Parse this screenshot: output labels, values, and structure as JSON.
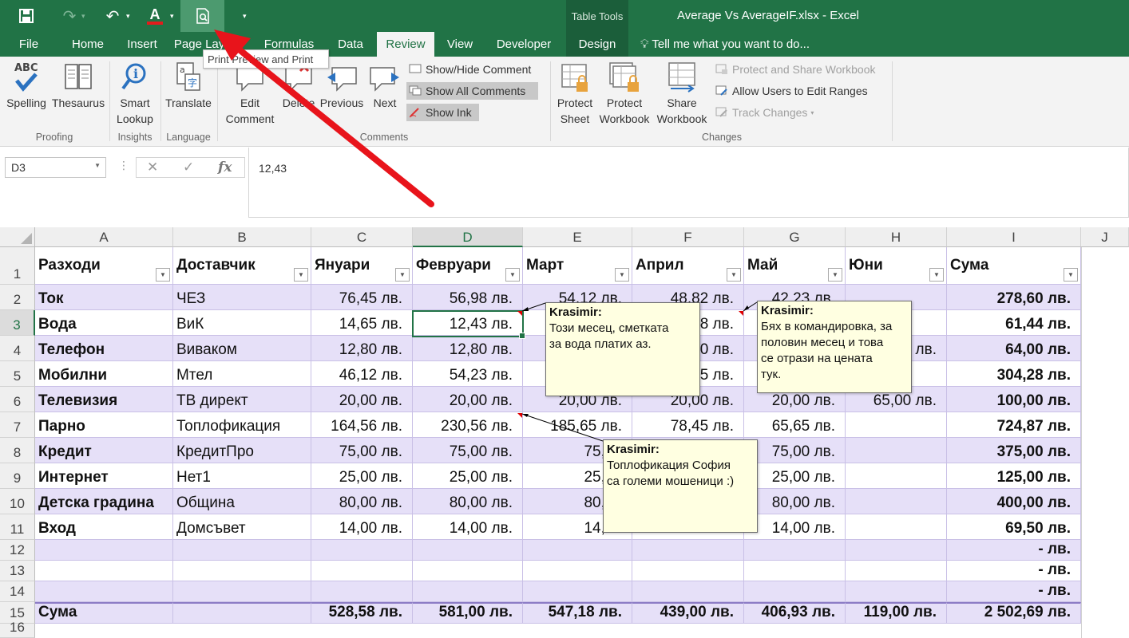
{
  "window": {
    "title": "Average Vs AverageIF.xlsx - Excel",
    "context_tab_group": "Table Tools"
  },
  "quick_access": {
    "tooltip": "Print Preview and Print"
  },
  "tabs": [
    {
      "label": "File",
      "selected": false
    },
    {
      "label": "Home",
      "selected": false
    },
    {
      "label": "Insert",
      "selected": false
    },
    {
      "label": "Page Layout",
      "selected": false
    },
    {
      "label": "Formulas",
      "selected": false
    },
    {
      "label": "Data",
      "selected": false
    },
    {
      "label": "Review",
      "selected": true
    },
    {
      "label": "View",
      "selected": false
    },
    {
      "label": "Developer",
      "selected": false
    },
    {
      "label": "Design",
      "selected": false
    }
  ],
  "tell_me": "Tell me what you want to do...",
  "ribbon": {
    "proofing": {
      "label": "Proofing",
      "spelling": "Spelling",
      "thesaurus": "Thesaurus"
    },
    "insights": {
      "label": "Insights",
      "smart_lookup_1": "Smart",
      "smart_lookup_2": "Lookup"
    },
    "language": {
      "label": "Language",
      "translate": "Translate"
    },
    "comments": {
      "label": "Comments",
      "edit_1": "Edit",
      "edit_2": "Comment",
      "delete": "Delete",
      "previous": "Previous",
      "next": "Next",
      "show_hide": "Show/Hide Comment",
      "show_all": "Show All Comments",
      "show_ink": "Show Ink"
    },
    "changes": {
      "label": "Changes",
      "protect_sheet_1": "Protect",
      "protect_sheet_2": "Sheet",
      "protect_workbook_1": "Protect",
      "protect_workbook_2": "Workbook",
      "share_workbook_1": "Share",
      "share_workbook_2": "Workbook",
      "protect_share": "Protect and Share Workbook",
      "allow_users": "Allow Users to Edit Ranges",
      "track_changes": "Track Changes"
    }
  },
  "formula_bar": {
    "name_box": "D3",
    "formula": "12,43"
  },
  "columns": [
    "A",
    "B",
    "C",
    "D",
    "E",
    "F",
    "G",
    "H",
    "I",
    "J"
  ],
  "row_numbers": [
    "1",
    "2",
    "3",
    "4",
    "5",
    "6",
    "7",
    "8",
    "9",
    "10",
    "11",
    "12",
    "13",
    "14",
    "15",
    "16"
  ],
  "table": {
    "headers": [
      "Разходи",
      "Доставчик",
      "Януари",
      "Февруари",
      "Март",
      "Април",
      "Май",
      "Юни",
      "Сума"
    ],
    "rows": [
      [
        "Ток",
        "ЧЕЗ",
        "76,45 лв.",
        "56,98 лв.",
        "54,12 лв.",
        "48,82 лв.",
        "42,23 лв.",
        "",
        "278,60 лв."
      ],
      [
        "Вода",
        "ВиК",
        "14,65 лв.",
        "12,43 лв.",
        "",
        "18 лв.",
        "",
        "",
        "61,44 лв."
      ],
      [
        "Телефон",
        "Виваком",
        "12,80 лв.",
        "12,80 лв.",
        "",
        "0 лв.",
        "",
        "лв.",
        "64,00 лв."
      ],
      [
        "Мобилни",
        "Мтел",
        "46,12 лв.",
        "54,23 лв.",
        "",
        "5 лв.",
        "",
        "",
        "304,28 лв."
      ],
      [
        "Телевизия",
        "ТВ директ",
        "20,00 лв.",
        "20,00 лв.",
        "20,00 лв.",
        "20,00 лв.",
        "20,00 лв.",
        "65,00 лв.",
        "100,00 лв."
      ],
      [
        "Парно",
        "Топлофикация",
        "164,56 лв.",
        "230,56 лв.",
        "185,65 лв.",
        "78,45 лв.",
        "65,65 лв.",
        "",
        "724,87 лв."
      ],
      [
        "Кредит",
        "КредитПро",
        "75,00 лв.",
        "75,00 лв.",
        "75,00",
        "",
        "75,00 лв.",
        "",
        "375,00 лв."
      ],
      [
        "Интернет",
        "Нет1",
        "25,00 лв.",
        "25,00 лв.",
        "25,00",
        "",
        "25,00 лв.",
        "",
        "125,00 лв."
      ],
      [
        "Детска градина",
        "Община",
        "80,00 лв.",
        "80,00 лв.",
        "80,00",
        "",
        "80,00 лв.",
        "",
        "400,00 лв."
      ],
      [
        "Вход",
        "Домсъвет",
        "14,00 лв.",
        "14,00 лв.",
        "14,00",
        "",
        "14,00 лв.",
        "",
        "69,50 лв."
      ],
      [
        "",
        "",
        "",
        "",
        "",
        "",
        "",
        "",
        "-     лв."
      ],
      [
        "",
        "",
        "",
        "",
        "",
        "",
        "",
        "",
        "-     лв."
      ],
      [
        "",
        "",
        "",
        "",
        "",
        "",
        "",
        "",
        "-     лв."
      ]
    ],
    "total_row": [
      "Сума",
      "",
      "528,58 лв.",
      "581,00 лв.",
      "547,18 лв.",
      "439,00 лв.",
      "406,93 лв.",
      "119,00 лв.",
      "2 502,69 лв."
    ]
  },
  "comments": [
    {
      "author": "Krasimir:",
      "lines": [
        "Този месец, сметката",
        "за вода платих аз."
      ]
    },
    {
      "author": "Krasimir:",
      "lines": [
        "Бях в командировка, за",
        "половин месец и това",
        "се отрази на цената",
        "тук."
      ]
    },
    {
      "author": "Krasimir:",
      "lines": [
        "Топлофикация София",
        "са големи мошеници :)"
      ]
    }
  ],
  "colors": {
    "accent": "#217346",
    "band": "#e6e0f8",
    "comment_bg": "#ffffe1",
    "annotation_arrow": "#e8141b"
  },
  "icons": [
    "save-icon",
    "redo-icon",
    "undo-icon",
    "font-color-icon",
    "print-preview-icon",
    "customize-qat-icon"
  ]
}
